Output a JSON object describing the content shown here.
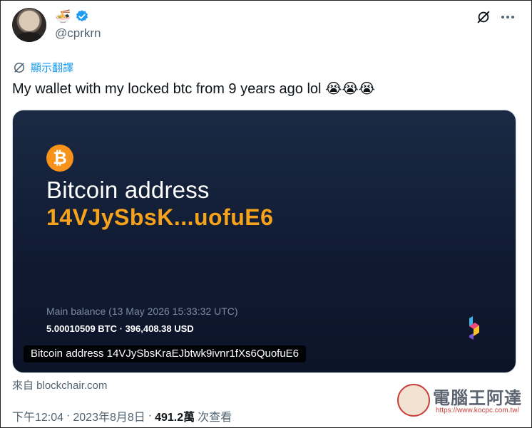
{
  "tweet": {
    "name_emoji": "🍜",
    "handle": "@cprkrn",
    "translate_label": "顯示翻譯",
    "text": "My wallet with my locked btc from 9 years ago lol",
    "text_emojis": "😭😭😭",
    "source": "來自 blockchair.com",
    "meta": {
      "time": "下午12:04",
      "date": "2023年8月8日",
      "views": "491.2萬",
      "views_label": "次查看",
      "separator": "·"
    }
  },
  "card": {
    "logo_symbol": "₿",
    "title": "Bitcoin address",
    "address_short": "14VJySbsK...uofuE6",
    "balance_label": "Main balance (13 May 2026 15:33:32 UTC)",
    "balance_value": "5.00010509 BTC · 396,408.38 USD",
    "caption": "Bitcoin address 14VJySbsKraEJbtwk9ivnr1fXs6QuofuE6"
  },
  "watermark": {
    "title": "電腦王阿達",
    "url": "https://www.kocpc.com.tw/"
  },
  "colors": {
    "link": "#1d9bf0",
    "bitcoin": "#f7931a",
    "card_bg": "#0f1a31",
    "muted": "#536471"
  }
}
